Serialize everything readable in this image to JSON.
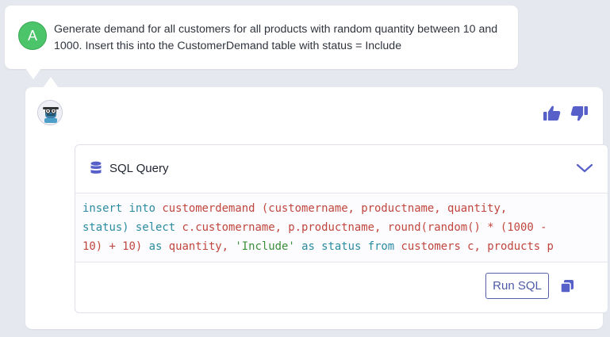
{
  "user_message": {
    "avatar_letter": "A",
    "text": "Generate demand for all customers for all products with random quantity between 10 and 1000. Insert this into the CustomerDemand table with status = Include"
  },
  "response": {
    "bot_avatar": "robot-avatar-icon",
    "feedback": {
      "thumbs_up": "thumbs-up-icon",
      "thumbs_down": "thumbs-down-icon"
    },
    "sql_panel": {
      "title": "SQL Query",
      "header_icon": "database-icon",
      "collapse_icon": "chevron-down-icon",
      "code_lines": [
        "insert into customerdemand (customername, productname, quantity,",
        "status) select c.customername, p.productname, round(random() * (1000 -",
        "10) + 10) as quantity, 'Include' as status from customers c, products p"
      ],
      "run_button_label": "Run SQL",
      "copy_icon": "copy-icon"
    }
  },
  "colors": {
    "background": "#e6e8ef",
    "accent": "#5660c8",
    "avatar_green": "#4cc46a",
    "keyword": "#2b8ba1",
    "identifier": "#c0463e",
    "string": "#3b8f3b"
  }
}
